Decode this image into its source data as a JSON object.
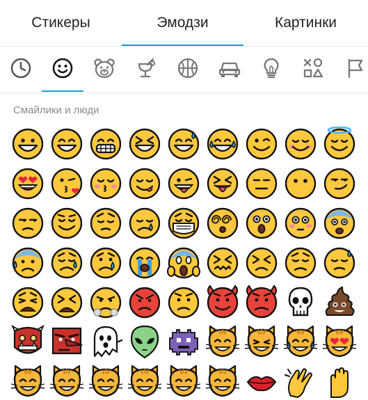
{
  "tabs": [
    {
      "label": "Стикеры",
      "active": false
    },
    {
      "label": "Эмодзи",
      "active": true
    },
    {
      "label": "Картинки",
      "active": false
    }
  ],
  "categories": [
    {
      "icon": "recent-clock-icon",
      "active": false
    },
    {
      "icon": "smiley-icon",
      "active": true
    },
    {
      "icon": "bear-icon",
      "active": false
    },
    {
      "icon": "food-cup-icon",
      "active": false
    },
    {
      "icon": "basketball-icon",
      "active": false
    },
    {
      "icon": "car-icon",
      "active": false
    },
    {
      "icon": "lightbulb-icon",
      "active": false
    },
    {
      "icon": "symbols-icon",
      "active": false
    },
    {
      "icon": "flag-icon",
      "active": false
    }
  ],
  "section_title": "Смайлики и люди",
  "colors": {
    "accent": "#1a9bd2",
    "face": "#ffc83d",
    "outline": "#111111"
  },
  "emoji_rows": [
    [
      "grinning",
      "grin",
      "grimace",
      "laugh-squint",
      "sweat-smile",
      "tears-joy",
      "wink",
      "blush",
      "halo"
    ],
    [
      "heart-eyes",
      "kiss-heart",
      "kiss-blush",
      "yum",
      "tongue-wink",
      "tongue-squint",
      "neutral",
      "no-mouth",
      "smirk"
    ],
    [
      "unamused",
      "relieved",
      "pensive",
      "sleepy",
      "mask",
      "dizzy",
      "astonished",
      "flushed",
      "fearful"
    ],
    [
      "cold-sweat",
      "disappointed",
      "cry",
      "sob",
      "scream",
      "confounded",
      "persevere",
      "worried",
      "downcast-sweat"
    ],
    [
      "weary",
      "tired",
      "triumph",
      "rage",
      "angry",
      "imp",
      "imp-red",
      "skull",
      "poop"
    ],
    [
      "ogre",
      "goblin",
      "ghost",
      "alien",
      "space-invader",
      "cat-smile",
      "cat-grin",
      "cat-joy",
      "cat-heart-eyes"
    ],
    [
      "cat",
      "cat",
      "cat",
      "cat",
      "cat",
      "cat",
      "lips",
      "clap",
      "hand"
    ]
  ]
}
